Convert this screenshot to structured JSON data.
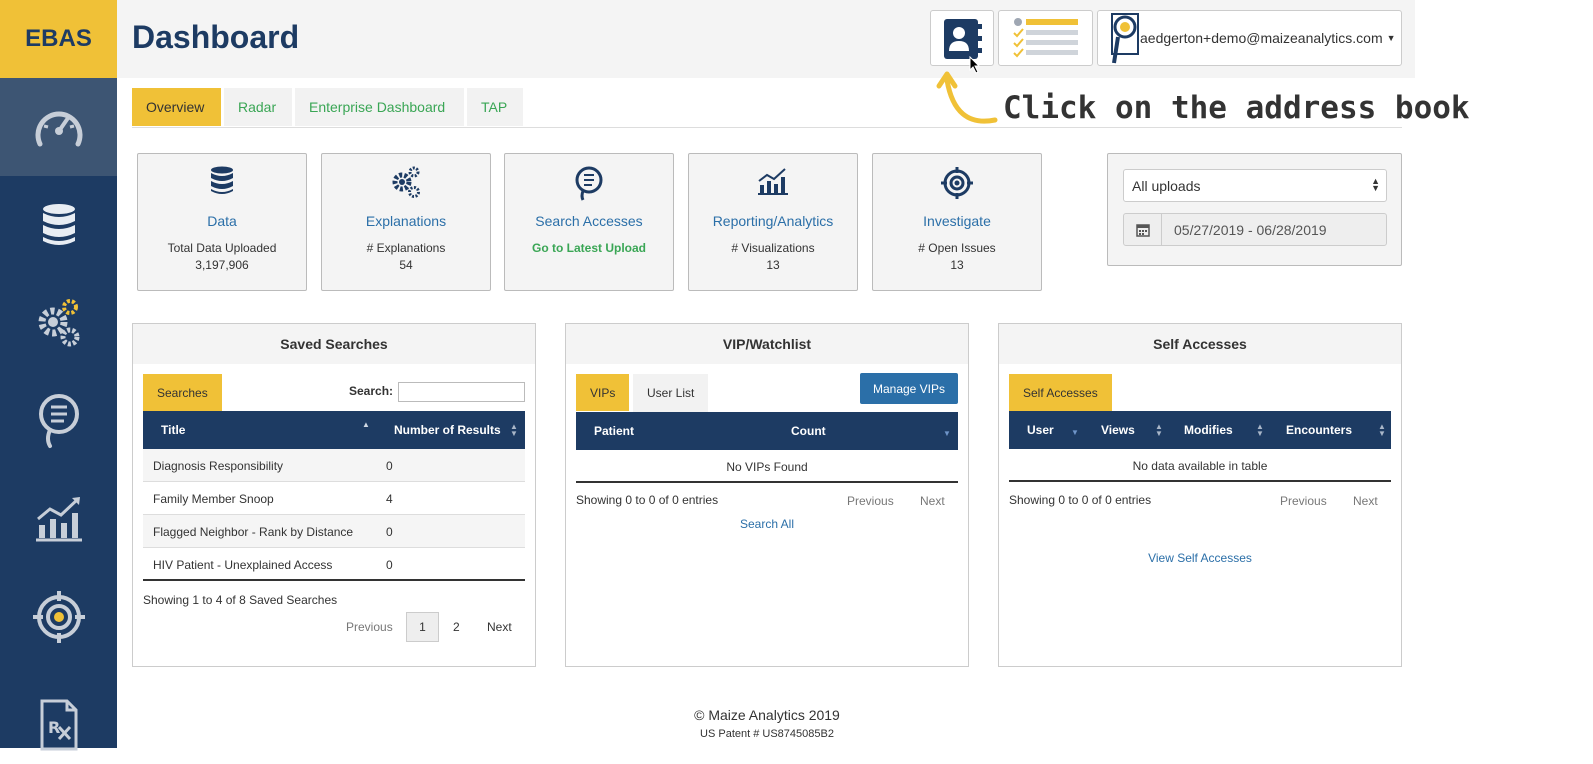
{
  "brand": "EBAS",
  "sidebar": {
    "items": [
      {
        "icon": "dashboard-gauge-icon",
        "active": true
      },
      {
        "icon": "database-icon",
        "active": false
      },
      {
        "icon": "gears-icon",
        "active": false
      },
      {
        "icon": "search-list-icon",
        "active": false
      },
      {
        "icon": "chart-icon",
        "active": false
      },
      {
        "icon": "crosshair-icon",
        "active": false
      },
      {
        "icon": "rx-document-icon",
        "active": false
      }
    ]
  },
  "header": {
    "title": "Dashboard",
    "user_email": "aedgerton+demo@maizeanalytics.com"
  },
  "tabs": [
    "Overview",
    "Radar",
    "Enterprise Dashboard",
    "TAP"
  ],
  "callout": "Click on the address book",
  "cards": [
    {
      "title": "Data",
      "sub": "Total Data Uploaded",
      "value": "3,197,906",
      "icon": "database-icon"
    },
    {
      "title": "Explanations",
      "sub": "# Explanations",
      "value": "54",
      "icon": "gears-icon"
    },
    {
      "title": "Search Accesses",
      "link": "Go to Latest Upload",
      "icon": "search-list-icon"
    },
    {
      "title": "Reporting/Analytics",
      "sub": "# Visualizations",
      "value": "13",
      "icon": "chart-icon"
    },
    {
      "title": "Investigate",
      "sub": "# Open Issues",
      "value": "13",
      "icon": "crosshair-icon"
    }
  ],
  "filter": {
    "upload_select": "All uploads",
    "date_range": "05/27/2019 - 06/28/2019"
  },
  "saved_searches": {
    "heading": "Saved Searches",
    "tab": "Searches",
    "search_label": "Search:",
    "columns": [
      "Title",
      "Number of Results"
    ],
    "rows": [
      {
        "title": "Diagnosis Responsibility",
        "count": "0"
      },
      {
        "title": "Family Member Snoop",
        "count": "4"
      },
      {
        "title": "Flagged Neighbor - Rank by Distance",
        "count": "0"
      },
      {
        "title": "HIV Patient - Unexplained Access",
        "count": "0"
      }
    ],
    "info": "Showing 1 to 4 of 8 Saved Searches",
    "pager": {
      "previous": "Previous",
      "pages": [
        "1",
        "2"
      ],
      "next": "Next"
    }
  },
  "vip": {
    "heading": "VIP/Watchlist",
    "tabs": [
      "VIPs",
      "User List"
    ],
    "manage_button": "Manage VIPs",
    "columns": [
      "Patient",
      "Count"
    ],
    "empty": "No VIPs Found",
    "info": "Showing 0 to 0 of 0 entries",
    "previous": "Previous",
    "next": "Next",
    "search_all": "Search All"
  },
  "self_accesses": {
    "heading": "Self Accesses",
    "tab": "Self Accesses",
    "columns": [
      "User",
      "Views",
      "Modifies",
      "Encounters"
    ],
    "empty": "No data available in table",
    "info": "Showing 0 to 0 of 0 entries",
    "previous": "Previous",
    "next": "Next",
    "view_link": "View Self Accesses"
  },
  "footer": {
    "copyright": "© Maize Analytics 2019",
    "patent": "US Patent # US8745085B2"
  },
  "colors": {
    "sidebar": "#1d3b63",
    "accent": "#f0c137",
    "link": "#2b6fa8",
    "green": "#3aa655"
  }
}
